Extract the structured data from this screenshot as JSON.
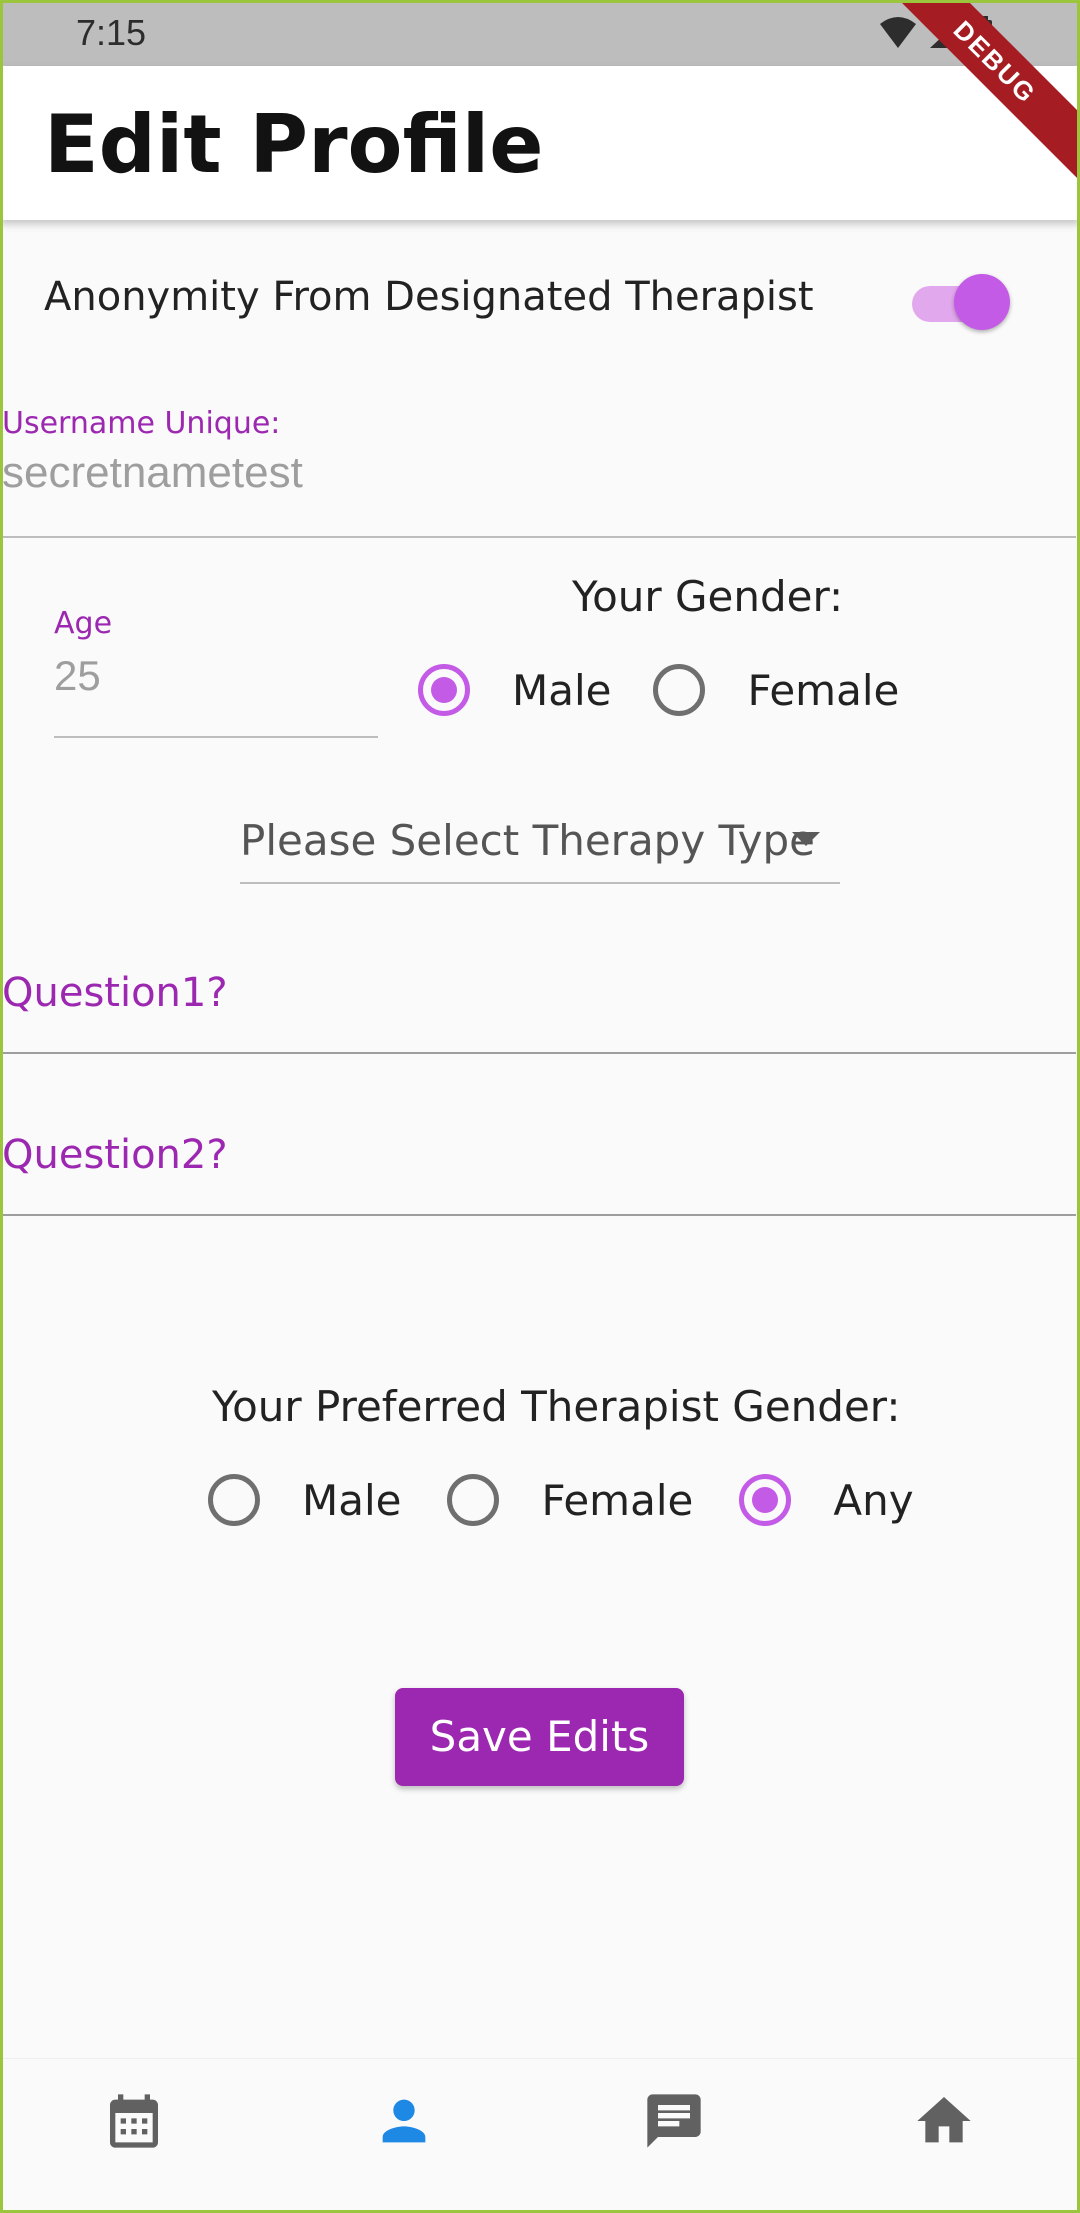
{
  "status_bar": {
    "time": "7:15",
    "debug_label": "DEBUG"
  },
  "app_bar": {
    "title": "Edit Profile"
  },
  "anonymity": {
    "label": "Anonymity From Designated Therapist",
    "enabled": true
  },
  "username": {
    "label": "Username Unique:",
    "value": "secretnametest"
  },
  "age": {
    "label": "Age",
    "value": "25"
  },
  "gender": {
    "title": "Your Gender:",
    "options": [
      {
        "label": "Male",
        "selected": true
      },
      {
        "label": "Female",
        "selected": false
      }
    ]
  },
  "therapy_type": {
    "placeholder": "Please Select Therapy Type"
  },
  "questions": [
    {
      "label": "Question1?"
    },
    {
      "label": "Question2?"
    }
  ],
  "preferred_gender": {
    "title": "Your Preferred Therapist Gender:",
    "options": [
      {
        "label": "Male",
        "selected": false
      },
      {
        "label": "Female",
        "selected": false
      },
      {
        "label": "Any",
        "selected": true
      }
    ]
  },
  "save_button": {
    "label": "Save Edits"
  },
  "bottom_nav": {
    "items": [
      {
        "icon": "calendar-icon",
        "active": false
      },
      {
        "icon": "person-icon",
        "active": true
      },
      {
        "icon": "chat-icon",
        "active": false
      },
      {
        "icon": "home-icon",
        "active": false
      }
    ]
  },
  "colors": {
    "accent": "#9c27b0",
    "switch_thumb": "#c45be7",
    "switch_track": "#e2a8ee",
    "nav_active": "#1e88e5",
    "nav_inactive": "#616161"
  }
}
